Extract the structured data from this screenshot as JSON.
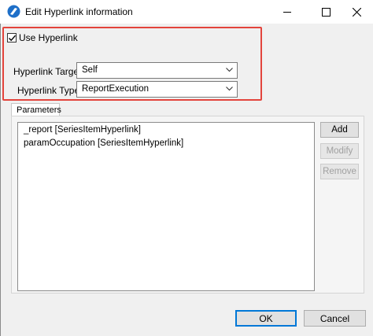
{
  "window": {
    "title": "Edit Hyperlink information",
    "minimize_icon": "minimize-icon",
    "maximize_icon": "maximize-icon",
    "close_icon": "close-icon",
    "app_icon": "app-logo-icon"
  },
  "use_hyperlink": {
    "label": "Use Hyperlink",
    "checked": true
  },
  "hyperlink_target": {
    "label": "Hyperlink Target",
    "value": "Self"
  },
  "hyperlink_type": {
    "label": "Hyperlink Type",
    "value": "ReportExecution"
  },
  "parameters": {
    "tab_label": "Parameters",
    "items": [
      "_report [SeriesItemHyperlink]",
      "paramOccupation [SeriesItemHyperlink]"
    ],
    "buttons": {
      "add": "Add",
      "modify": "Modify",
      "remove": "Remove"
    }
  },
  "footer": {
    "ok": "OK",
    "cancel": "Cancel"
  },
  "colors": {
    "highlight": "#e3443c",
    "default_button_border": "#0078d7"
  }
}
